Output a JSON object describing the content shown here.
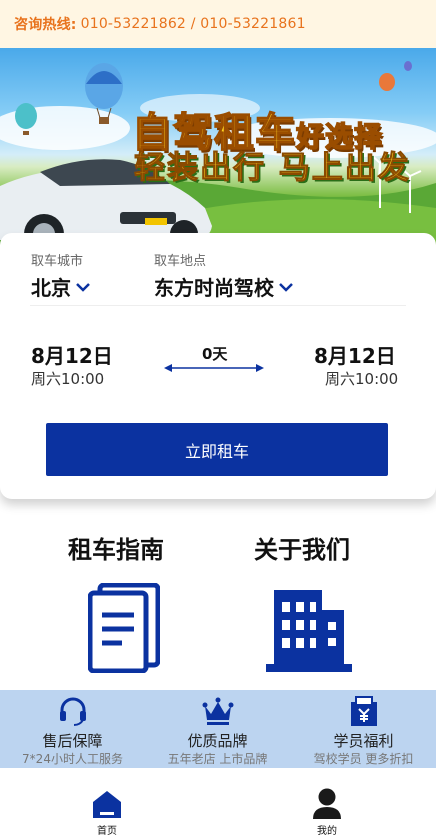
{
  "hotline": {
    "label": "咨询热线:",
    "numbers": "010-53221862 / 010-53221861"
  },
  "banner": {
    "title_main": "自驾租车",
    "title_small": "好选择",
    "subtitle": "轻装出行 马上出发"
  },
  "rental": {
    "city_label": "取车城市",
    "city_value": "北京",
    "location_label": "取车地点",
    "location_value": "东方时尚驾校",
    "pickup_date": "8月12日",
    "pickup_time": "周六10:00",
    "duration": "0天",
    "return_date": "8月12日",
    "return_time": "周六10:00",
    "submit_label": "立即租车"
  },
  "features": [
    {
      "title": "租车指南",
      "icon": "document-icon"
    },
    {
      "title": "关于我们",
      "icon": "building-icon"
    }
  ],
  "services": [
    {
      "title": "售后保障",
      "desc": "7*24小时人工服务",
      "icon": "headset-icon"
    },
    {
      "title": "优质品牌",
      "desc": "五年老店 上市品牌",
      "icon": "crown-icon"
    },
    {
      "title": "学员福利",
      "desc": "驾校学员 更多折扣",
      "icon": "coupon-icon"
    }
  ],
  "nav": [
    {
      "label": "首页",
      "icon": "home-icon"
    },
    {
      "label": "我的",
      "icon": "user-icon"
    }
  ],
  "colors": {
    "primary": "#0b32a0",
    "hotline_text": "#e8731d",
    "hotline_bg": "#fff6e3",
    "services_bg": "#bcd4f0"
  }
}
